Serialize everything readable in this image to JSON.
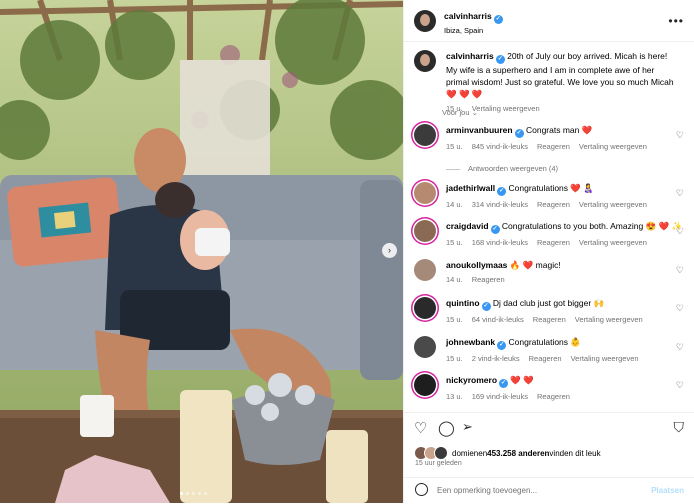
{
  "post": {
    "author": "calvinharris",
    "location": "Ibiza, Spain",
    "caption_author": "calvinharris",
    "caption": "20th of July our boy arrived. Micah is here! My wife is a superhero and I am in complete awe of her primal wisdom! Just so grateful. We love you so much Micah",
    "caption_emoji": "❤️ ❤️ ❤️",
    "caption_time": "15 u.",
    "caption_translate": "Vertaling weergeven",
    "for_you": "Voor jou",
    "likes_prefix": "domien",
    "likes_middle": " en ",
    "likes_count": "453.258 anderen",
    "likes_suffix": " vinden dit leuk",
    "posted": "15 uur geleden",
    "comment_placeholder": "Een opmerking toevoegen...",
    "post_button": "Plaatsen"
  },
  "comments": [
    {
      "user": "arminvanbuuren",
      "text": "Congrats man ❤️",
      "time": "15 u.",
      "likes": "845 vind-ik-leuks",
      "reply": "Reageren",
      "translate": "Vertaling weergeven",
      "view_replies": "Antwoorden weergeven (4)"
    },
    {
      "user": "jadethirlwall",
      "text": "Congratulations ❤️ 👩‍🍼",
      "time": "14 u.",
      "likes": "314 vind-ik-leuks",
      "reply": "Reageren",
      "translate": "Vertaling weergeven"
    },
    {
      "user": "craigdavid",
      "text": "Congratulations to you both. Amazing 😍 ❤️ ✨",
      "time": "15 u.",
      "likes": "168 vind-ik-leuks",
      "reply": "Reageren",
      "translate": "Vertaling weergeven"
    },
    {
      "user": "anoukollymaas",
      "text": "🔥 ❤️ magic!",
      "time": "14 u.",
      "reply": "Reageren"
    },
    {
      "user": "quintino",
      "text": "Dj dad club just got bigger 🙌",
      "time": "15 u.",
      "likes": "64 vind-ik-leuks",
      "reply": "Reageren",
      "translate": "Vertaling weergeven"
    },
    {
      "user": "johnewbank",
      "text": "Congratulations 👶",
      "time": "15 u.",
      "likes": "2 vind-ik-leuks",
      "reply": "Reageren",
      "translate": "Vertaling weergeven"
    },
    {
      "user": "nickyromero",
      "text": "❤️ ❤️",
      "time": "13 u.",
      "likes": "169 vind-ik-leuks",
      "reply": "Reageren"
    }
  ],
  "icons": {
    "like": "heart-icon",
    "comment": "comment-icon",
    "share": "share-icon",
    "save": "bookmark-icon",
    "more": "more-icon",
    "next": "chevron-right-icon",
    "emoji": "emoji-icon"
  },
  "colors": {
    "verified": "#3897f0",
    "link": "#0095f6",
    "muted": "#737373"
  }
}
